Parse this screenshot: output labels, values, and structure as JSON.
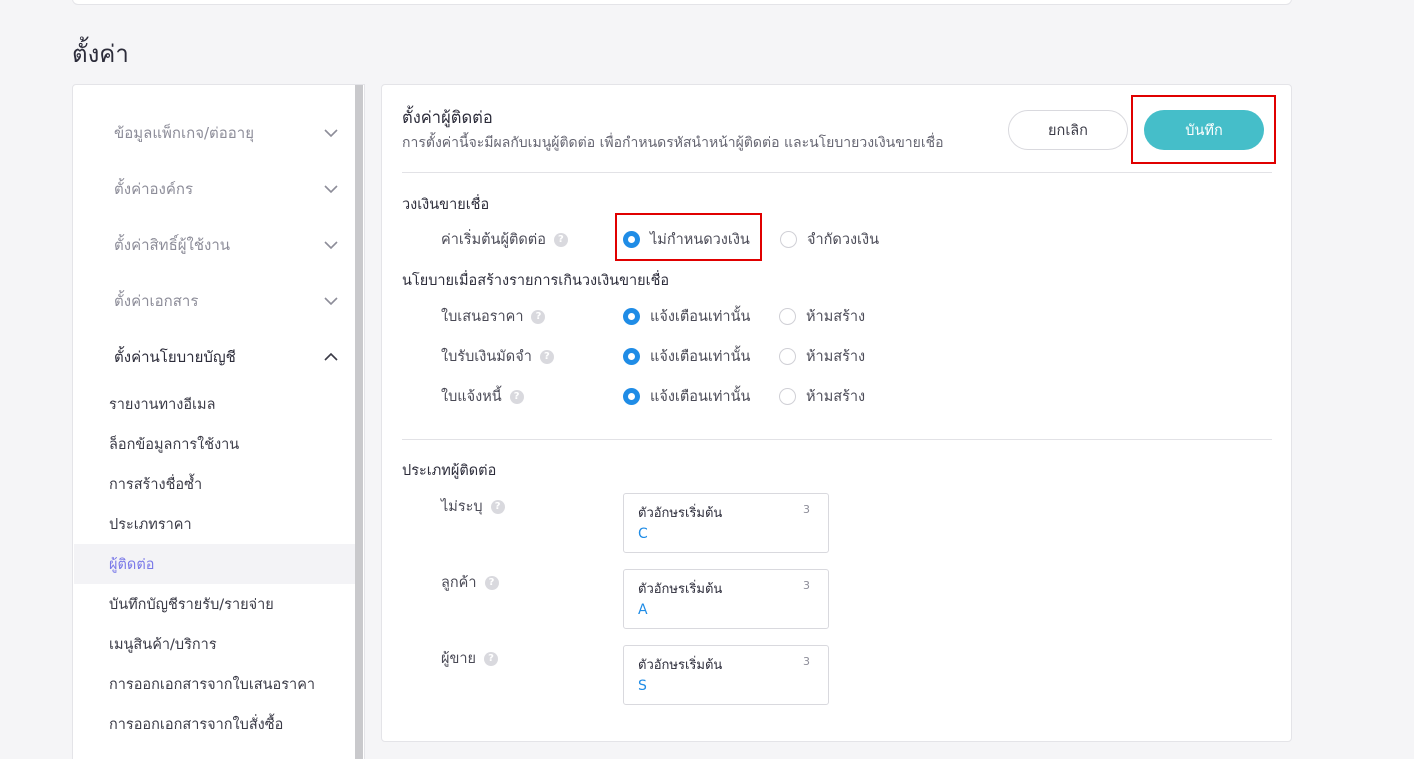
{
  "page": {
    "title": "ตั้งค่า"
  },
  "sidebar": {
    "groups": [
      {
        "label": "ข้อมูลแพ็กเกจ/ต่ออายุ"
      },
      {
        "label": "ตั้งค่าองค์กร"
      },
      {
        "label": "ตั้งค่าสิทธิ์ผู้ใช้งาน"
      },
      {
        "label": "ตั้งค่าเอกสาร"
      },
      {
        "label": "ตั้งค่านโยบายบัญชี"
      }
    ],
    "items": [
      {
        "label": "รายงานทางอีเมล"
      },
      {
        "label": "ล็อกข้อมูลการใช้งาน"
      },
      {
        "label": "การสร้างชื่อซ้ำ"
      },
      {
        "label": "ประเภทราคา"
      },
      {
        "label": "ผู้ติดต่อ"
      },
      {
        "label": "บันทึกบัญชีรายรับ/รายจ่าย"
      },
      {
        "label": "เมนูสินค้า/บริการ"
      },
      {
        "label": "การออกเอกสารจากใบเสนอราคา"
      },
      {
        "label": "การออกเอกสารจากใบสั่งซื้อ"
      }
    ],
    "active_item": "ผู้ติดต่อ"
  },
  "panel": {
    "title": "ตั้งค่าผู้ติดต่อ",
    "description": "การตั้งค่านี้จะมีผลกับเมนูผู้ติดต่อ เพื่อกำหนดรหัสนำหน้าผู้ติดต่อ และนโยบายวงเงินขายเชื่อ",
    "cancel_label": "ยกเลิก",
    "save_label": "บันทึก"
  },
  "credit_limit": {
    "title": "วงเงินขายเชื่อ",
    "row_label": "ค่าเริ่มต้นผู้ติดต่อ",
    "options": [
      {
        "label": "ไม่กำหนดวงเงิน",
        "selected": true
      },
      {
        "label": "จำกัดวงเงิน",
        "selected": false
      }
    ]
  },
  "over_limit_policy": {
    "title": "นโยบายเมื่อสร้างรายการเกินวงเงินขายเชื่อ",
    "option_warn": "แจ้งเตือนเท่านั้น",
    "option_block": "ห้ามสร้าง",
    "rows": [
      {
        "label": "ใบเสนอราคา",
        "selected": "warn"
      },
      {
        "label": "ใบรับเงินมัดจำ",
        "selected": "warn"
      },
      {
        "label": "ใบแจ้งหนี้",
        "selected": "warn"
      }
    ]
  },
  "contact_types": {
    "title": "ประเภทผู้ติดต่อ",
    "prefix_label": "ตัวอักษรเริ่มต้น",
    "rows": [
      {
        "label": "ไม่ระบุ",
        "prefix": "C",
        "max_length": "3"
      },
      {
        "label": "ลูกค้า",
        "prefix": "A",
        "max_length": "3"
      },
      {
        "label": "ผู้ขาย",
        "prefix": "S",
        "max_length": "3"
      }
    ]
  },
  "colors": {
    "accent": "#45bec9",
    "radio_selected": "#1f8ce6",
    "active_nav": "#7a79e8",
    "highlight_box": "#e00000"
  }
}
